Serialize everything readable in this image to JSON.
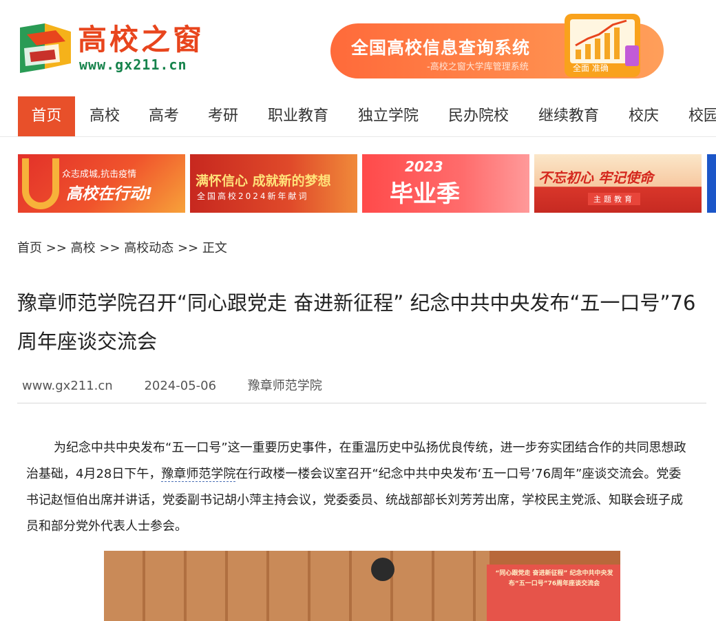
{
  "header": {
    "logo_name": "高校之窗",
    "logo_domain": "www.gx211.cn",
    "ad": {
      "title": "全国高校信息查询系统",
      "subtitle": "-高校之窗大学库管理系统",
      "tagline": "全面 准确"
    }
  },
  "nav": {
    "items": [
      "首页",
      "高校",
      "高考",
      "考研",
      "职业教育",
      "独立学院",
      "民办院校",
      "继续教育",
      "校庆",
      "校园"
    ],
    "active": "首页",
    "active_color": "#e8502a"
  },
  "banners": [
    {
      "line1": "众志成城,抗击疫情",
      "line2": "高校在行动!"
    },
    {
      "line1": "满怀信心 成就新的梦想",
      "line2": "全国高校2024新年献词"
    },
    {
      "line1": "2023",
      "line2": "毕业季"
    },
    {
      "line1": "不忘初心 牢记使命",
      "line2": "主题教育"
    }
  ],
  "breadcrumb": {
    "items": [
      "首页",
      "高校",
      "高校动态",
      "正文"
    ],
    "separator": ">>"
  },
  "article": {
    "title": "豫章师范学院召开“同心跟党走 奋进新征程” 纪念中共中央发布“五一口号”76周年座谈交流会",
    "source_site": "www.gx211.cn",
    "date": "2024-05-06",
    "author": "豫章师范学院",
    "body_before_link": "为纪念中共中央发布“五一口号”这一重要历史事件，在重温历史中弘扬优良传统，进一步夯实团结合作的共同思想政治基础，4月28日下午，",
    "body_link": "豫章师范学院",
    "body_after_link": "在行政楼一楼会议室召开“纪念中共中央发布‘五一口号’76周年”座谈交流会。党委书记赵恒伯出席并讲话，党委副书记胡小萍主持会议，党委委员、统战部部长刘芳芳出席，学校民主党派、知联会班子成员和部分党外代表人士参会。",
    "photo_screen_text": "“同心跟党走 奋进新征程” 纪念中共中央发布“五一口号”76周年座谈交流会"
  },
  "colors": {
    "brand_orange": "#e8451d",
    "brand_green": "#16834c"
  }
}
